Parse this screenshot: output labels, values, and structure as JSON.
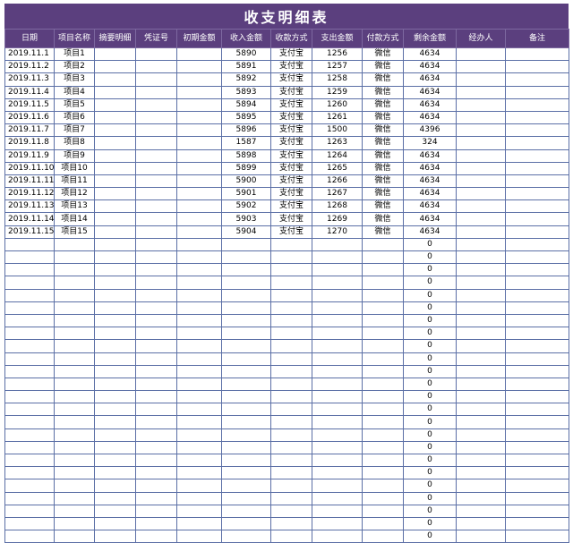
{
  "title": "收支明细表",
  "colors": {
    "header_bg": "#5b3f7e",
    "header_text": "#ffffff",
    "grid": "#5b6fa6"
  },
  "columns": [
    "日期",
    "项目名称",
    "摘要明细",
    "凭证号",
    "初期金额",
    "收入金额",
    "收款方式",
    "支出金额",
    "付款方式",
    "剩余金额",
    "经办人",
    "备注"
  ],
  "rows": [
    [
      "2019.11.1",
      "项目1",
      "",
      "",
      "",
      "5890",
      "支付宝",
      "1256",
      "微信",
      "4634",
      "",
      ""
    ],
    [
      "2019.11.2",
      "项目2",
      "",
      "",
      "",
      "5891",
      "支付宝",
      "1257",
      "微信",
      "4634",
      "",
      ""
    ],
    [
      "2019.11.3",
      "项目3",
      "",
      "",
      "",
      "5892",
      "支付宝",
      "1258",
      "微信",
      "4634",
      "",
      ""
    ],
    [
      "2019.11.4",
      "项目4",
      "",
      "",
      "",
      "5893",
      "支付宝",
      "1259",
      "微信",
      "4634",
      "",
      ""
    ],
    [
      "2019.11.5",
      "项目5",
      "",
      "",
      "",
      "5894",
      "支付宝",
      "1260",
      "微信",
      "4634",
      "",
      ""
    ],
    [
      "2019.11.6",
      "项目6",
      "",
      "",
      "",
      "5895",
      "支付宝",
      "1261",
      "微信",
      "4634",
      "",
      ""
    ],
    [
      "2019.11.7",
      "项目7",
      "",
      "",
      "",
      "5896",
      "支付宝",
      "1500",
      "微信",
      "4396",
      "",
      ""
    ],
    [
      "2019.11.8",
      "项目8",
      "",
      "",
      "",
      "1587",
      "支付宝",
      "1263",
      "微信",
      "324",
      "",
      ""
    ],
    [
      "2019.11.9",
      "项目9",
      "",
      "",
      "",
      "5898",
      "支付宝",
      "1264",
      "微信",
      "4634",
      "",
      ""
    ],
    [
      "2019.11.10",
      "项目10",
      "",
      "",
      "",
      "5899",
      "支付宝",
      "1265",
      "微信",
      "4634",
      "",
      ""
    ],
    [
      "2019.11.11",
      "项目11",
      "",
      "",
      "",
      "5900",
      "支付宝",
      "1266",
      "微信",
      "4634",
      "",
      ""
    ],
    [
      "2019.11.12",
      "项目12",
      "",
      "",
      "",
      "5901",
      "支付宝",
      "1267",
      "微信",
      "4634",
      "",
      ""
    ],
    [
      "2019.11.13",
      "项目13",
      "",
      "",
      "",
      "5902",
      "支付宝",
      "1268",
      "微信",
      "4634",
      "",
      ""
    ],
    [
      "2019.11.14",
      "项目14",
      "",
      "",
      "",
      "5903",
      "支付宝",
      "1269",
      "微信",
      "4634",
      "",
      ""
    ],
    [
      "2019.11.15",
      "项目15",
      "",
      "",
      "",
      "5904",
      "支付宝",
      "1270",
      "微信",
      "4634",
      "",
      ""
    ],
    [
      "",
      "",
      "",
      "",
      "",
      "",
      "",
      "",
      "",
      "0",
      "",
      ""
    ],
    [
      "",
      "",
      "",
      "",
      "",
      "",
      "",
      "",
      "",
      "0",
      "",
      ""
    ],
    [
      "",
      "",
      "",
      "",
      "",
      "",
      "",
      "",
      "",
      "0",
      "",
      ""
    ],
    [
      "",
      "",
      "",
      "",
      "",
      "",
      "",
      "",
      "",
      "0",
      "",
      ""
    ],
    [
      "",
      "",
      "",
      "",
      "",
      "",
      "",
      "",
      "",
      "0",
      "",
      ""
    ],
    [
      "",
      "",
      "",
      "",
      "",
      "",
      "",
      "",
      "",
      "0",
      "",
      ""
    ],
    [
      "",
      "",
      "",
      "",
      "",
      "",
      "",
      "",
      "",
      "0",
      "",
      ""
    ],
    [
      "",
      "",
      "",
      "",
      "",
      "",
      "",
      "",
      "",
      "0",
      "",
      ""
    ],
    [
      "",
      "",
      "",
      "",
      "",
      "",
      "",
      "",
      "",
      "0",
      "",
      ""
    ],
    [
      "",
      "",
      "",
      "",
      "",
      "",
      "",
      "",
      "",
      "0",
      "",
      ""
    ],
    [
      "",
      "",
      "",
      "",
      "",
      "",
      "",
      "",
      "",
      "0",
      "",
      ""
    ],
    [
      "",
      "",
      "",
      "",
      "",
      "",
      "",
      "",
      "",
      "0",
      "",
      ""
    ],
    [
      "",
      "",
      "",
      "",
      "",
      "",
      "",
      "",
      "",
      "0",
      "",
      ""
    ],
    [
      "",
      "",
      "",
      "",
      "",
      "",
      "",
      "",
      "",
      "0",
      "",
      ""
    ],
    [
      "",
      "",
      "",
      "",
      "",
      "",
      "",
      "",
      "",
      "0",
      "",
      ""
    ],
    [
      "",
      "",
      "",
      "",
      "",
      "",
      "",
      "",
      "",
      "0",
      "",
      ""
    ],
    [
      "",
      "",
      "",
      "",
      "",
      "",
      "",
      "",
      "",
      "0",
      "",
      ""
    ],
    [
      "",
      "",
      "",
      "",
      "",
      "",
      "",
      "",
      "",
      "0",
      "",
      ""
    ],
    [
      "",
      "",
      "",
      "",
      "",
      "",
      "",
      "",
      "",
      "0",
      "",
      ""
    ],
    [
      "",
      "",
      "",
      "",
      "",
      "",
      "",
      "",
      "",
      "0",
      "",
      ""
    ],
    [
      "",
      "",
      "",
      "",
      "",
      "",
      "",
      "",
      "",
      "0",
      "",
      ""
    ],
    [
      "",
      "",
      "",
      "",
      "",
      "",
      "",
      "",
      "",
      "0",
      "",
      ""
    ],
    [
      "",
      "",
      "",
      "",
      "",
      "",
      "",
      "",
      "",
      "0",
      "",
      ""
    ],
    [
      "",
      "",
      "",
      "",
      "",
      "",
      "",
      "",
      "",
      "0",
      "",
      ""
    ]
  ]
}
